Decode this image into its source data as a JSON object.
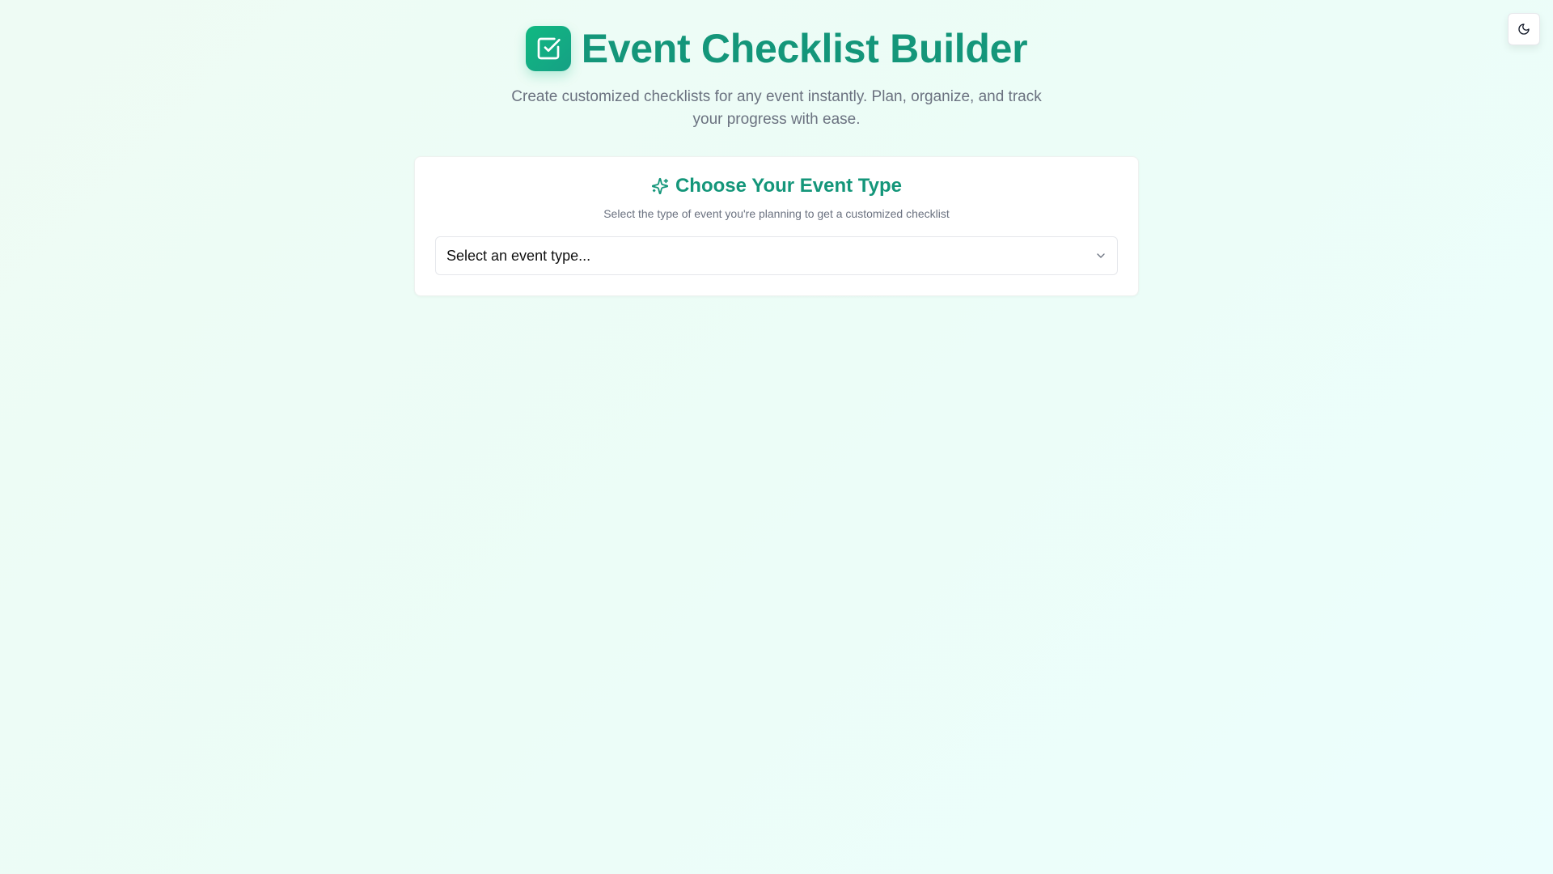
{
  "app": {
    "title": "Event Checklist Builder",
    "subtitle": "Create customized checklists for any event instantly. Plan, organize, and track your progress with ease.",
    "logo_icon": "check-square-icon"
  },
  "theme_toggle": {
    "icon": "moon-icon"
  },
  "event_type_card": {
    "title": "Choose Your Event Type",
    "title_icon": "sparkles-icon",
    "subtitle": "Select the type of event you're planning to get a customized checklist",
    "select": {
      "selected_value": "Select an event type...",
      "icon": "chevron-down-icon"
    }
  },
  "colors": {
    "accent": "#14967a",
    "logo_gradient_start": "#10b981",
    "logo_gradient_end": "#16a085",
    "muted_text": "#6b7280"
  }
}
